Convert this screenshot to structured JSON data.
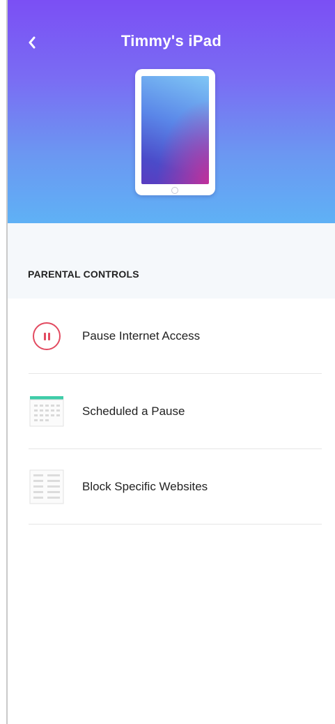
{
  "header": {
    "title": "Timmy's iPad",
    "back_icon": "chevron-left-icon"
  },
  "device": {
    "illustration": "tablet-icon"
  },
  "parental_controls": {
    "section_title": "PARENTAL CONTROLS",
    "items": [
      {
        "label": "Pause Internet Access",
        "icon": "pause-icon"
      },
      {
        "label": "Scheduled a Pause",
        "icon": "calendar-icon"
      },
      {
        "label": "Block Specific Websites",
        "icon": "website-list-icon"
      }
    ]
  },
  "colors": {
    "header_top": "#7b4ff4",
    "header_bottom": "#5fb1f5",
    "pause_accent": "#e24a60",
    "calendar_accent": "#3fcca8"
  }
}
